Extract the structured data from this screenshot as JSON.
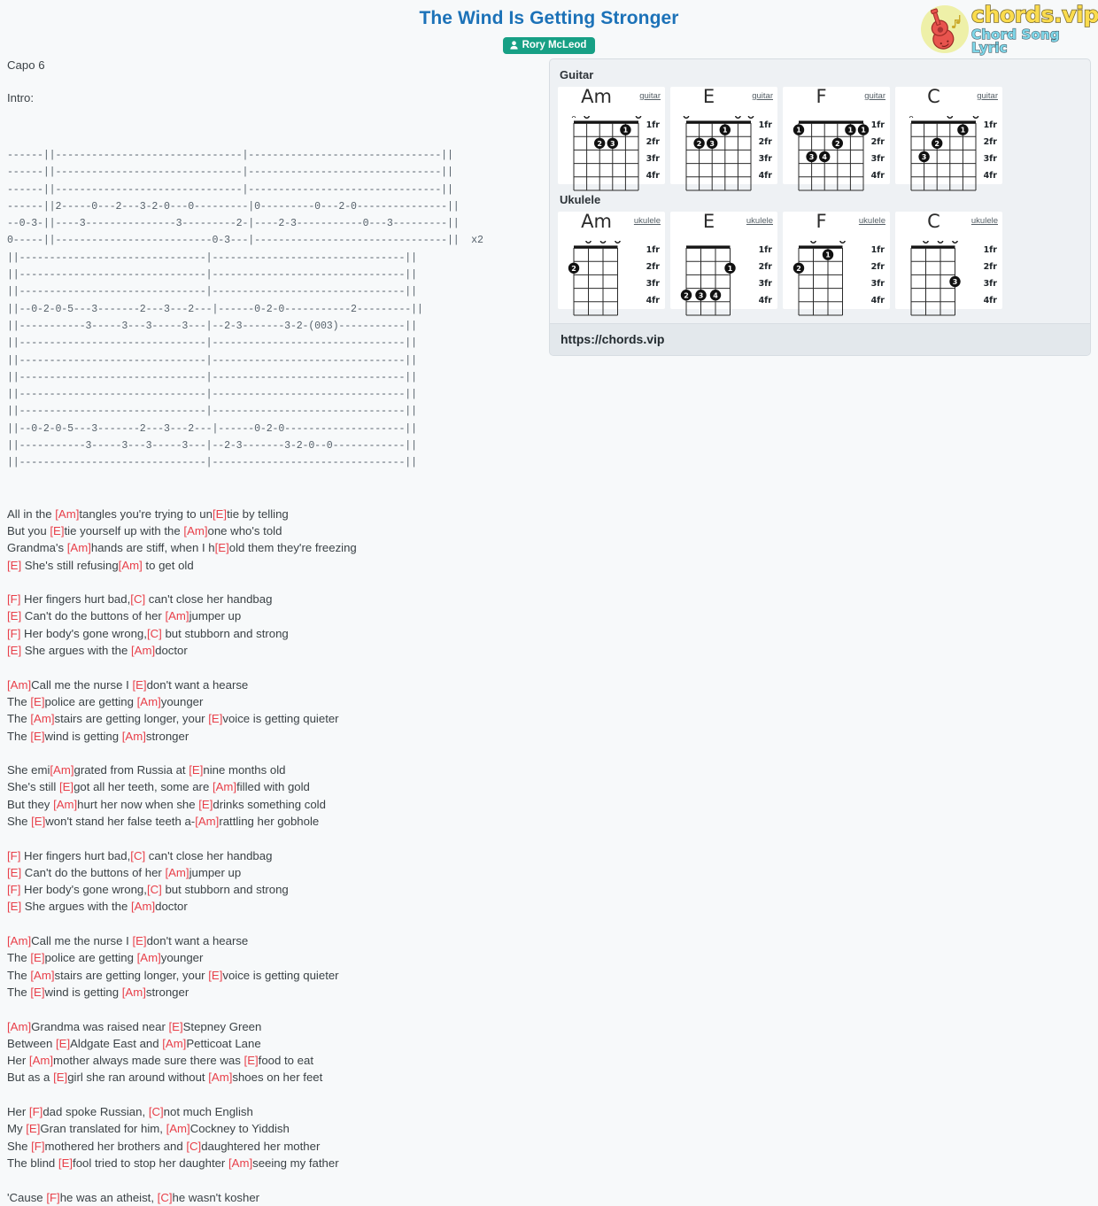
{
  "header": {
    "title": "The Wind Is Getting Stronger",
    "artist": "Rory McLeod",
    "artist_icon": "user-icon"
  },
  "logo": {
    "main": "chords.vip",
    "sub": "Chord Song Lyric",
    "icon": "guitar-icon"
  },
  "meta": {
    "capo": "Capo 6",
    "intro": "Intro:"
  },
  "tab_blocks": [
    "------||-------------------------------|--------------------------------|| \n------||-------------------------------|--------------------------------|| \n------||-------------------------------|--------------------------------|| \n------||2-----0---2---3-2-0---0---------|0---------0---2-0---------------|| \n--0-3-||----3---------------3---------2-|----2-3-----------0---3---------|| \n0-----||--------------------------0-3---|--------------------------------||  x2",
    "||-------------------------------|--------------------------------|| \n||-------------------------------|--------------------------------|| \n||-------------------------------|--------------------------------|| \n||--0-2-0-5---3-------2---3---2---|------0-2-0-----------2---------|| \n||-----------3-----3---3-----3---|--2-3-------3-2-(003)-----------|| \n||-------------------------------|--------------------------------|| ",
    "||-------------------------------|--------------------------------|| \n||-------------------------------|--------------------------------|| \n||-------------------------------|--------------------------------|| \n||-------------------------------|--------------------------------|| \n||--0-2-0-5---3-------2---3---2---|------0-2-0--------------------|| \n||-----------3-----3---3-----3---|--2-3-------3-2-0--0------------|| \n||-------------------------------|--------------------------------|| "
  ],
  "lyrics": [
    [
      {
        "t": "All in the "
      },
      {
        "c": "[Am]"
      },
      {
        "t": "tangles you're trying to un"
      },
      {
        "c": "[E]"
      },
      {
        "t": "tie by telling"
      }
    ],
    [
      {
        "t": "But you "
      },
      {
        "c": "[E]"
      },
      {
        "t": "tie yourself up with the "
      },
      {
        "c": "[Am]"
      },
      {
        "t": "one who's told"
      }
    ],
    [
      {
        "t": "Grandma's "
      },
      {
        "c": "[Am]"
      },
      {
        "t": "hands are stiff, when I h"
      },
      {
        "c": "[E]"
      },
      {
        "t": "old them they're freezing"
      }
    ],
    [
      {
        "c": "[E]"
      },
      {
        "t": " She's still refusing"
      },
      {
        "c": "[Am]"
      },
      {
        "t": " to get old"
      }
    ],
    [],
    [
      {
        "c": "[F]"
      },
      {
        "t": " Her fingers hurt bad,"
      },
      {
        "c": "[C]"
      },
      {
        "t": " can't close her handbag"
      }
    ],
    [
      {
        "c": "[E]"
      },
      {
        "t": " Can't do the buttons of her "
      },
      {
        "c": "[Am]"
      },
      {
        "t": "jumper up"
      }
    ],
    [
      {
        "c": "[F]"
      },
      {
        "t": " Her body's gone wrong,"
      },
      {
        "c": "[C]"
      },
      {
        "t": " but stubborn and strong"
      }
    ],
    [
      {
        "c": "[E]"
      },
      {
        "t": " She argues with the "
      },
      {
        "c": "[Am]"
      },
      {
        "t": "doctor"
      }
    ],
    [],
    [
      {
        "c": "[Am]"
      },
      {
        "t": "Call me the nurse I "
      },
      {
        "c": "[E]"
      },
      {
        "t": "don't want a hearse"
      }
    ],
    [
      {
        "t": "The "
      },
      {
        "c": "[E]"
      },
      {
        "t": "police are getting "
      },
      {
        "c": "[Am]"
      },
      {
        "t": "younger"
      }
    ],
    [
      {
        "t": "The "
      },
      {
        "c": "[Am]"
      },
      {
        "t": "stairs are getting longer, your "
      },
      {
        "c": "[E]"
      },
      {
        "t": "voice is getting quieter"
      }
    ],
    [
      {
        "t": "The "
      },
      {
        "c": "[E]"
      },
      {
        "t": "wind is getting "
      },
      {
        "c": "[Am]"
      },
      {
        "t": "stronger"
      }
    ],
    [],
    [
      {
        "t": "She emi"
      },
      {
        "c": "[Am]"
      },
      {
        "t": "grated from Russia at "
      },
      {
        "c": "[E]"
      },
      {
        "t": "nine months old"
      }
    ],
    [
      {
        "t": "She's still "
      },
      {
        "c": "[E]"
      },
      {
        "t": "got all her teeth, some are "
      },
      {
        "c": "[Am]"
      },
      {
        "t": "filled with gold"
      }
    ],
    [
      {
        "t": "But they "
      },
      {
        "c": "[Am]"
      },
      {
        "t": "hurt her now when she "
      },
      {
        "c": "[E]"
      },
      {
        "t": "drinks something cold"
      }
    ],
    [
      {
        "t": "She "
      },
      {
        "c": "[E]"
      },
      {
        "t": "won't stand her false teeth a-"
      },
      {
        "c": "[Am]"
      },
      {
        "t": "rattling her gobhole"
      }
    ],
    [],
    [
      {
        "c": "[F]"
      },
      {
        "t": " Her fingers hurt bad,"
      },
      {
        "c": "[C]"
      },
      {
        "t": " can't close her handbag"
      }
    ],
    [
      {
        "c": "[E]"
      },
      {
        "t": " Can't do the buttons of her "
      },
      {
        "c": "[Am]"
      },
      {
        "t": "jumper up"
      }
    ],
    [
      {
        "c": "[F]"
      },
      {
        "t": " Her body's gone wrong,"
      },
      {
        "c": "[C]"
      },
      {
        "t": " but stubborn and strong"
      }
    ],
    [
      {
        "c": "[E]"
      },
      {
        "t": " She argues with the "
      },
      {
        "c": "[Am]"
      },
      {
        "t": "doctor"
      }
    ],
    [],
    [
      {
        "c": "[Am]"
      },
      {
        "t": "Call me the nurse I "
      },
      {
        "c": "[E]"
      },
      {
        "t": "don't want a hearse"
      }
    ],
    [
      {
        "t": "The "
      },
      {
        "c": "[E]"
      },
      {
        "t": "police are getting "
      },
      {
        "c": "[Am]"
      },
      {
        "t": "younger"
      }
    ],
    [
      {
        "t": "The "
      },
      {
        "c": "[Am]"
      },
      {
        "t": "stairs are getting longer, your "
      },
      {
        "c": "[E]"
      },
      {
        "t": "voice is getting quieter"
      }
    ],
    [
      {
        "t": "The "
      },
      {
        "c": "[E]"
      },
      {
        "t": "wind is getting "
      },
      {
        "c": "[Am]"
      },
      {
        "t": "stronger"
      }
    ],
    [],
    [
      {
        "c": "[Am]"
      },
      {
        "t": "Grandma was raised near "
      },
      {
        "c": "[E]"
      },
      {
        "t": "Stepney Green"
      }
    ],
    [
      {
        "t": "Between "
      },
      {
        "c": "[E]"
      },
      {
        "t": "Aldgate East and "
      },
      {
        "c": "[Am]"
      },
      {
        "t": "Petticoat Lane"
      }
    ],
    [
      {
        "t": "Her "
      },
      {
        "c": "[Am]"
      },
      {
        "t": "mother always made sure there was "
      },
      {
        "c": "[E]"
      },
      {
        "t": "food to eat"
      }
    ],
    [
      {
        "t": "But as a "
      },
      {
        "c": "[E]"
      },
      {
        "t": "girl she ran around without "
      },
      {
        "c": "[Am]"
      },
      {
        "t": "shoes on her feet"
      }
    ],
    [],
    [
      {
        "t": "Her "
      },
      {
        "c": "[F]"
      },
      {
        "t": "dad spoke Russian, "
      },
      {
        "c": "[C]"
      },
      {
        "t": "not much English"
      }
    ],
    [
      {
        "t": "My "
      },
      {
        "c": "[E]"
      },
      {
        "t": "Gran translated for him, "
      },
      {
        "c": "[Am]"
      },
      {
        "t": "Cockney to Yiddish"
      }
    ],
    [
      {
        "t": "She "
      },
      {
        "c": "[F]"
      },
      {
        "t": "mothered her brothers and "
      },
      {
        "c": "[C]"
      },
      {
        "t": "daughtered her mother"
      }
    ],
    [
      {
        "t": "The blind "
      },
      {
        "c": "[E]"
      },
      {
        "t": "fool tried to stop her daughter "
      },
      {
        "c": "[Am]"
      },
      {
        "t": "seeing my father"
      }
    ],
    [],
    [
      {
        "t": "'Cause "
      },
      {
        "c": "[F]"
      },
      {
        "t": "he was an atheist, "
      },
      {
        "c": "[C]"
      },
      {
        "t": "he wasn't kosher"
      }
    ]
  ],
  "chord_panel": {
    "sections": [
      {
        "label": "Guitar",
        "strings": 6,
        "diagrams": [
          {
            "name": "Am",
            "kind": "guitar",
            "fret_labels": [
              "1fr",
              "2fr",
              "3fr",
              "4fr"
            ],
            "open_marks": [
              "x",
              "o",
              "",
              "",
              "",
              "o"
            ],
            "dots": [
              {
                "string": 2,
                "fret": 1,
                "finger": "1"
              },
              {
                "string": 4,
                "fret": 2,
                "finger": "2"
              },
              {
                "string": 3,
                "fret": 2,
                "finger": "3"
              }
            ]
          },
          {
            "name": "E",
            "kind": "guitar",
            "fret_labels": [
              "1fr",
              "2fr",
              "3fr",
              "4fr"
            ],
            "open_marks": [
              "o",
              "",
              "",
              "",
              "o",
              "o"
            ],
            "dots": [
              {
                "string": 3,
                "fret": 1,
                "finger": "1"
              },
              {
                "string": 5,
                "fret": 2,
                "finger": "2"
              },
              {
                "string": 4,
                "fret": 2,
                "finger": "3"
              }
            ]
          },
          {
            "name": "F",
            "kind": "guitar",
            "fret_labels": [
              "1fr",
              "2fr",
              "3fr",
              "4fr"
            ],
            "open_marks": [
              "",
              "",
              "",
              "",
              "",
              ""
            ],
            "dots": [
              {
                "string": 6,
                "fret": 1,
                "finger": "1"
              },
              {
                "string": 2,
                "fret": 1,
                "finger": "1"
              },
              {
                "string": 1,
                "fret": 1,
                "finger": "1"
              },
              {
                "string": 3,
                "fret": 2,
                "finger": "2"
              },
              {
                "string": 5,
                "fret": 3,
                "finger": "3"
              },
              {
                "string": 4,
                "fret": 3,
                "finger": "4"
              }
            ]
          },
          {
            "name": "C",
            "kind": "guitar",
            "fret_labels": [
              "1fr",
              "2fr",
              "3fr",
              "4fr"
            ],
            "open_marks": [
              "x",
              "",
              "",
              "o",
              "",
              "o"
            ],
            "dots": [
              {
                "string": 2,
                "fret": 1,
                "finger": "1"
              },
              {
                "string": 4,
                "fret": 2,
                "finger": "2"
              },
              {
                "string": 5,
                "fret": 3,
                "finger": "3"
              }
            ]
          }
        ]
      },
      {
        "label": "Ukulele",
        "strings": 4,
        "diagrams": [
          {
            "name": "Am",
            "kind": "ukulele",
            "fret_labels": [
              "1fr",
              "2fr",
              "3fr",
              "4fr"
            ],
            "open_marks": [
              "",
              "o",
              "o",
              "o"
            ],
            "dots": [
              {
                "string": 4,
                "fret": 2,
                "finger": "2"
              }
            ]
          },
          {
            "name": "E",
            "kind": "ukulele",
            "fret_labels": [
              "1fr",
              "2fr",
              "3fr",
              "4fr"
            ],
            "open_marks": [
              "",
              "",
              "",
              ""
            ],
            "dots": [
              {
                "string": 1,
                "fret": 2,
                "finger": "1"
              },
              {
                "string": 4,
                "fret": 4,
                "finger": "2"
              },
              {
                "string": 3,
                "fret": 4,
                "finger": "3"
              },
              {
                "string": 2,
                "fret": 4,
                "finger": "4"
              }
            ]
          },
          {
            "name": "F",
            "kind": "ukulele",
            "fret_labels": [
              "1fr",
              "2fr",
              "3fr",
              "4fr"
            ],
            "open_marks": [
              "",
              "o",
              "",
              "o"
            ],
            "dots": [
              {
                "string": 2,
                "fret": 1,
                "finger": "1"
              },
              {
                "string": 4,
                "fret": 2,
                "finger": "2"
              }
            ]
          },
          {
            "name": "C",
            "kind": "ukulele",
            "fret_labels": [
              "1fr",
              "2fr",
              "3fr",
              "4fr"
            ],
            "open_marks": [
              "",
              "o",
              "o",
              "o"
            ],
            "dots": [
              {
                "string": 1,
                "fret": 3,
                "finger": "3"
              }
            ]
          }
        ]
      }
    ],
    "footer_url": "https://chords.vip"
  }
}
